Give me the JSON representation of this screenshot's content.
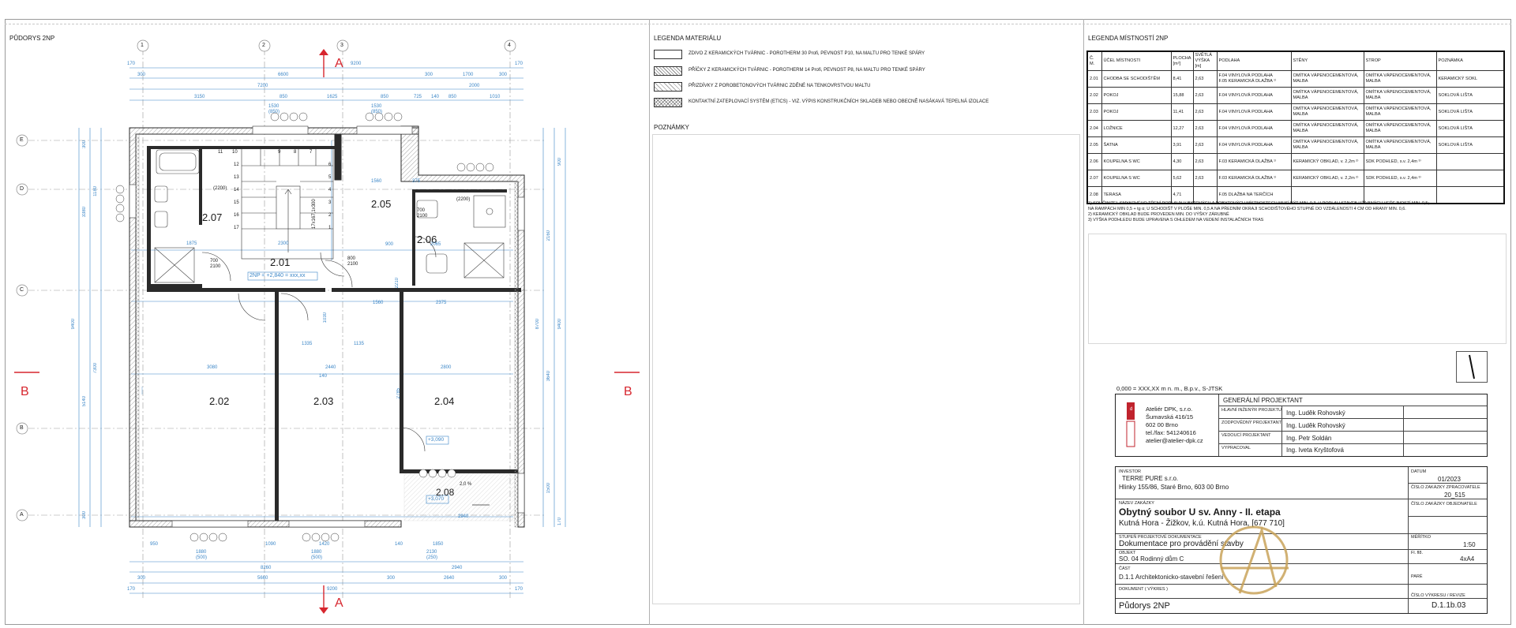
{
  "plan": {
    "title": "PŮDORYS 2NP",
    "section_mark": "A",
    "section_mark_side": "B",
    "axes_top": [
      "1",
      "2",
      "3",
      "4"
    ],
    "axes_left": [
      "E",
      "D",
      "C",
      "B",
      "A"
    ],
    "rooms": [
      {
        "id": "2.01"
      },
      {
        "id": "2.02"
      },
      {
        "id": "2.03"
      },
      {
        "id": "2.04"
      },
      {
        "id": "2.05"
      },
      {
        "id": "2.06"
      },
      {
        "id": "2.07"
      },
      {
        "id": "2.08"
      }
    ],
    "dims_top_row1": [
      "170",
      "9200",
      "170"
    ],
    "dims_top_row2": [
      "300",
      "6600",
      "300",
      "1700",
      "300"
    ],
    "dims_top_row3": [
      "7200",
      "2000"
    ],
    "dims_top_row4": [
      "3150",
      "850",
      "1625",
      "850",
      "725",
      "140",
      "850",
      "1010"
    ],
    "dims_top_row5": [
      "1530 (850)",
      "1530 (850)"
    ],
    "dims_bottom_row1": [
      "950",
      "1880 (500)",
      "1090",
      "1420",
      "1880 (500)",
      "140",
      "1850",
      "2130 (250)"
    ],
    "dims_bottom_row2": [
      "8260",
      "2940"
    ],
    "dims_bottom_row3": [
      "300",
      "5660",
      "300",
      "2640",
      "300"
    ],
    "dims_bottom_row4": [
      "170",
      "9200",
      "170"
    ],
    "dims_left": [
      "300",
      "3380",
      "9400",
      "5140",
      "7300",
      "1180",
      "300"
    ],
    "dims_right": [
      "2160",
      "900",
      "8700",
      "3640",
      "1500",
      "9400",
      "170"
    ],
    "inner_dims": [
      "2300",
      "3080",
      "2440",
      "2800",
      "1560",
      "2375",
      "1135",
      "1335",
      "140",
      "1030",
      "375",
      "1560",
      "2065",
      "900",
      "2210",
      "2785",
      "2940",
      "1875"
    ],
    "door_dims": [
      "700\n2100",
      "800\n2100",
      "700\n2100",
      "800\n2100",
      "800\n2100",
      "800\n2100"
    ],
    "stair_label": "17x167,1x300",
    "stair_steps": [
      "1",
      "2",
      "3",
      "4",
      "5",
      "6",
      "7",
      "8",
      "9",
      "10",
      "11",
      "12",
      "13",
      "14",
      "15",
      "16",
      "17"
    ],
    "level_2np": "2NP = +2,840 = xxx,xx",
    "level_terrace1": "+3,090",
    "level_terrace2": "+3,070",
    "slope": "2,0 %",
    "window_codes": [
      "ZZ",
      "O",
      "K",
      "KK"
    ],
    "bath_note": "(2200)"
  },
  "materials_legend": {
    "title": "LEGENDA MATERIÁLU",
    "items": [
      {
        "pattern": "plain",
        "text": "ZDIVO Z KERAMICKÝCH TVÁRNIC - POROTHERM 30 Profi, PEVNOST P10, NA MALTU PRO TENKÉ SPÁRY"
      },
      {
        "pattern": "hatch",
        "text": "PŘÍČKY Z KERAMICKÝCH TVÁRNIC - POROTHERM 14 Profi, PEVNOST P8, NA MALTU PRO TENKÉ SPÁRY"
      },
      {
        "pattern": "hatch",
        "text": "PŘIZDÍVKY Z POROBETONOVÝCH TVÁRNIC ZDĚNÉ NA TENKOVRSTVOU MALTU"
      },
      {
        "pattern": "cross",
        "text": "KONTAKTNÍ ZATEPLOVACÍ SYSTÉM (ETICS) - VIZ. VÝPIS KONSTRUKČNÍCH SKLADEB NEBO OBECNĚ NASÁKAVÁ TEPELNÁ IZOLACE"
      }
    ],
    "notes_title": "POZNÁMKY"
  },
  "rooms_legend": {
    "title": "LEGENDA MÍSTNOSTÍ 2NP",
    "headers": [
      "Č. M.",
      "ÚČEL MÍSTNOSTI",
      "PLOCHA [m²]",
      "SVĚTLÁ VÝŠKA [m]",
      "PODLAHA",
      "STĚNY",
      "STROP",
      "POZNÁMKA"
    ],
    "rows": [
      [
        "2.01",
        "CHODBA SE SCHODIŠTĚM",
        "8,41",
        "2,63",
        "F.04  VINYLOVÁ PODLAHA\nF.05  KERAMICKÁ DLAŽBA ¹⁾",
        "OMÍTKA VÁPENOCEMENTOVÁ, MALBA",
        "OMÍTKA VÁPENOCEMENTOVÁ, MALBA",
        "KERAMICKÝ SOKL"
      ],
      [
        "2.02",
        "POKOJ",
        "15,88",
        "2,63",
        "F.04  VINYLOVÁ PODLAHA",
        "OMÍTKA VÁPENOCEMENTOVÁ, MALBA",
        "OMÍTKA VÁPENOCEMENTOVÁ, MALBA",
        "SOKLOVÁ LIŠTA"
      ],
      [
        "2.03",
        "POKOJ",
        "11,41",
        "2,63",
        "F.04  VINYLOVÁ PODLAHA",
        "OMÍTKA VÁPENOCEMENTOVÁ, MALBA",
        "OMÍTKA VÁPENOCEMENTOVÁ, MALBA",
        "SOKLOVÁ LIŠTA"
      ],
      [
        "2.04",
        "LOŽNICE",
        "12,27",
        "2,63",
        "F.04  VINYLOVÁ PODLAHA",
        "OMÍTKA VÁPENOCEMENTOVÁ, MALBA",
        "OMÍTKA VÁPENOCEMENTOVÁ, MALBA",
        "SOKLOVÁ LIŠTA"
      ],
      [
        "2.05",
        "ŠATNA",
        "3,91",
        "2,63",
        "F.04  VINYLOVÁ PODLAHA",
        "OMÍTKA VÁPENOCEMENTOVÁ, MALBA",
        "OMÍTKA VÁPENOCEMENTOVÁ, MALBA",
        "SOKLOVÁ LIŠTA"
      ],
      [
        "2.06",
        "KOUPELNA S WC",
        "4,30",
        "2,63",
        "F.03  KERAMICKÁ DLAŽBA ¹⁾",
        "KERAMICKÝ OBKLAD, v. 2,2m ²⁾",
        "SDK PODHLED, s.v. 2,4m ³⁾",
        ""
      ],
      [
        "2.07",
        "KOUPELNA S WC",
        "5,62",
        "2,63",
        "F.03  KERAMICKÁ DLAŽBA ¹⁾",
        "KERAMICKÝ OBKLAD, v. 2,2m ²⁾",
        "SDK PODHLED, s.v. 2,4m ³⁾",
        ""
      ],
      [
        "2.08",
        "TERASA",
        "4,71",
        "",
        "F.05  DLAŽBA NA TERČÍCH",
        "",
        "",
        ""
      ]
    ],
    "footnotes": [
      "1)   SOUČINITEL SMYKOVÉHO TŘENÍ PODLAHY V BYTOVÝCH A POBYTOVÝCH MÍSTNOSTECH MUSÍ BÝT MIN. 0,3. U PODLAH STAVEB UŽÍVANÝCH VEŘEJNOSTÍ MIN. 0,5;",
      "NA RAMPÁCH MIN 0,5 + tg α; U SCHODIŠŤ V PLOŠE MIN. 0,5 A NA PŘEDNÍM OKRAJI SCHODIŠŤOVÉHO STUPNĚ DO VZDÁLENOSTI 4 CM OD HRANY MIN. 0,6.",
      "2)   KERAMICKÝ OBKLAD BUDE PROVEDEN MIN. DO VÝŠKY ZÁRUBNĚ",
      "3)   VÝŠKA PODHLEDU BUDE UPRAVENA S OHLEDEM NA VEDENÍ INSTALAČNÍCH TRAS"
    ]
  },
  "title_block": {
    "reference": "0,000 = XXX,XX m n. m., B.p.v., S-JTSK",
    "designer_header": "GENERÁLNÍ PROJEKTANT",
    "company": [
      "Ateliér DPK, s.r.o.",
      "Šumavská 416/15",
      "602 00 Brno",
      "tel./fax: 541240616",
      "atelier@atelier-dpk.cz"
    ],
    "roles": [
      {
        "label": "HLAVNÍ INŽENÝR PROJEKTU",
        "name": "Ing. Luděk Rohovský"
      },
      {
        "label": "ZODPOVĚDNÝ PROJEKTANT",
        "name": "Ing. Luděk Rohovský"
      },
      {
        "label": "VEDOUCÍ PROJEKTANT",
        "name": "Ing. Petr Soldán"
      },
      {
        "label": "VYPRACOVAL",
        "name": "Ing. Iveta Kryštofová"
      }
    ],
    "investor_label": "INVESTOR",
    "investor": [
      "TERRE PURE s.r.o.",
      "Hlinky 155/86, Staré Brno, 603 00 Brno"
    ],
    "contract_label": "NÁZEV ZAKÁZKY",
    "contract_title": "Obytný soubor U sv. Anny - II. etapa",
    "contract_place": "Kutná Hora - Žižkov, k.ú. Kutná Hora, [677 710]",
    "stage_label": "STUPEŇ PROJEKTOVÉ DOKUMENTACE",
    "stage": "Dokumentace pro provádění stavby",
    "object_label": "OBJEKT",
    "object": "SO. 04   Rodinný dům C",
    "part_label": "ČÁST",
    "part": "D.1.1 Architektonicko-stavební řešení",
    "drawing_label": "DOKUMENT  ( VÝKRES )",
    "drawing": "Půdorys 2NP",
    "date_label": "DATUM",
    "date": "01/2023",
    "no_label": "ČÍSLO ZAKÁZKY ZPRACOVATELE",
    "no": "20_515",
    "client_no_label": "ČÍSLO ZAKÁZKY OBJEDNATELE",
    "client_no": "-----",
    "scale_label": "MĚŘÍTKO",
    "scale": "1:50",
    "format_label": "Fl. fl8.",
    "format": "4xA4",
    "paré_label": "PARÉ",
    "sheet_label": "ČÍSLO VÝKRESU / REVIZE",
    "sheet": "D.1.1b.03"
  },
  "colors": {
    "dim_blue": "#3b86c7",
    "red_mark": "#d7262e",
    "logo_red": "#c0232d",
    "gold": "#c9a35a",
    "wall": "#2a2a2a"
  }
}
